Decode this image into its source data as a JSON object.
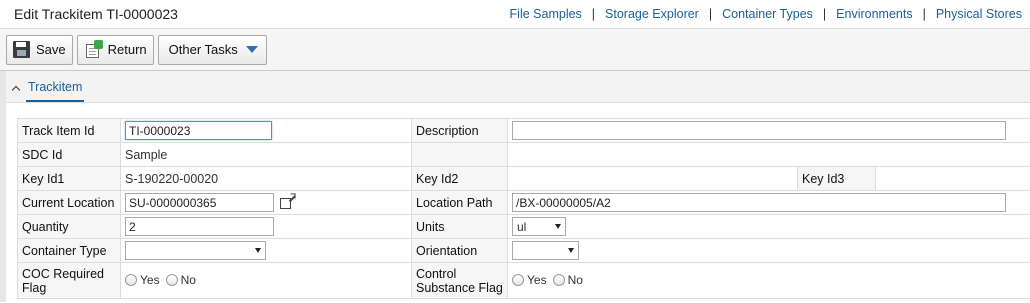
{
  "page": {
    "title": "Edit Trackitem TI-0000023"
  },
  "nav_links": [
    "File Samples",
    "Storage Explorer",
    "Container Types",
    "Environments",
    "Physical Stores"
  ],
  "toolbar": {
    "save_label": "Save",
    "return_label": "Return",
    "other_tasks_label": "Other Tasks"
  },
  "section": {
    "tab_label": "Trackitem"
  },
  "form": {
    "track_item_id": {
      "label": "Track Item Id",
      "value": "TI-0000023"
    },
    "description": {
      "label": "Description",
      "value": ""
    },
    "sdc_id": {
      "label": "SDC Id",
      "value": "Sample"
    },
    "key_id1": {
      "label": "Key Id1",
      "value": "S-190220-00020"
    },
    "key_id2": {
      "label": "Key Id2",
      "value": ""
    },
    "key_id3": {
      "label": "Key Id3",
      "value": ""
    },
    "current_location": {
      "label": "Current Location",
      "value": "SU-0000000365"
    },
    "location_path": {
      "label": "Location Path",
      "value": "/BX-00000005/A2"
    },
    "quantity": {
      "label": "Quantity",
      "value": "2"
    },
    "units": {
      "label": "Units",
      "value": "ul"
    },
    "container_type": {
      "label": "Container Type",
      "value": ""
    },
    "orientation": {
      "label": "Orientation",
      "value": ""
    },
    "coc_required_flag": {
      "label_line1": "COC Required",
      "label_line2": "Flag",
      "yes": "Yes",
      "no": "No"
    },
    "control_substance_flag": {
      "label_line1": "Control",
      "label_line2": "Substance Flag",
      "yes": "Yes",
      "no": "No"
    }
  },
  "icons": {
    "save": "save-icon",
    "return": "return-icon",
    "other_tasks": "caret-down-icon",
    "collapse": "chevron-up-icon",
    "open_location": "external-link-icon"
  },
  "colors": {
    "link": "#1a5e9a",
    "accent": "#2f6fb1",
    "input_focus": "#5b8dd6"
  }
}
